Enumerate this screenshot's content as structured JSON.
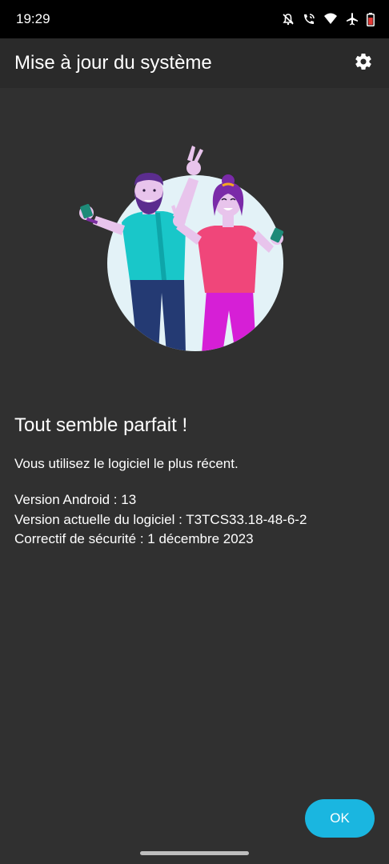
{
  "status_bar": {
    "time": "19:29",
    "icons": [
      "mute-icon",
      "wifi-calling-icon",
      "wifi-icon",
      "airplane-mode-icon",
      "battery-low-icon"
    ],
    "battery_color": "#e53935"
  },
  "app_bar": {
    "title": "Mise à jour du système",
    "settings_icon": "gear-icon"
  },
  "main": {
    "illustration": "celebrating-people-illustration",
    "heading": "Tout semble parfait !",
    "subtitle": "Vous utilisez le logiciel le plus récent.",
    "info": {
      "android_version": "Version Android : 13",
      "software_version": "Version actuelle du logiciel : T3TCS33.18-48-6-2",
      "security_patch": "Correctif de sécurité : 1 décembre 2023"
    }
  },
  "actions": {
    "ok_label": "OK",
    "accent_color": "#1ab6e0"
  }
}
